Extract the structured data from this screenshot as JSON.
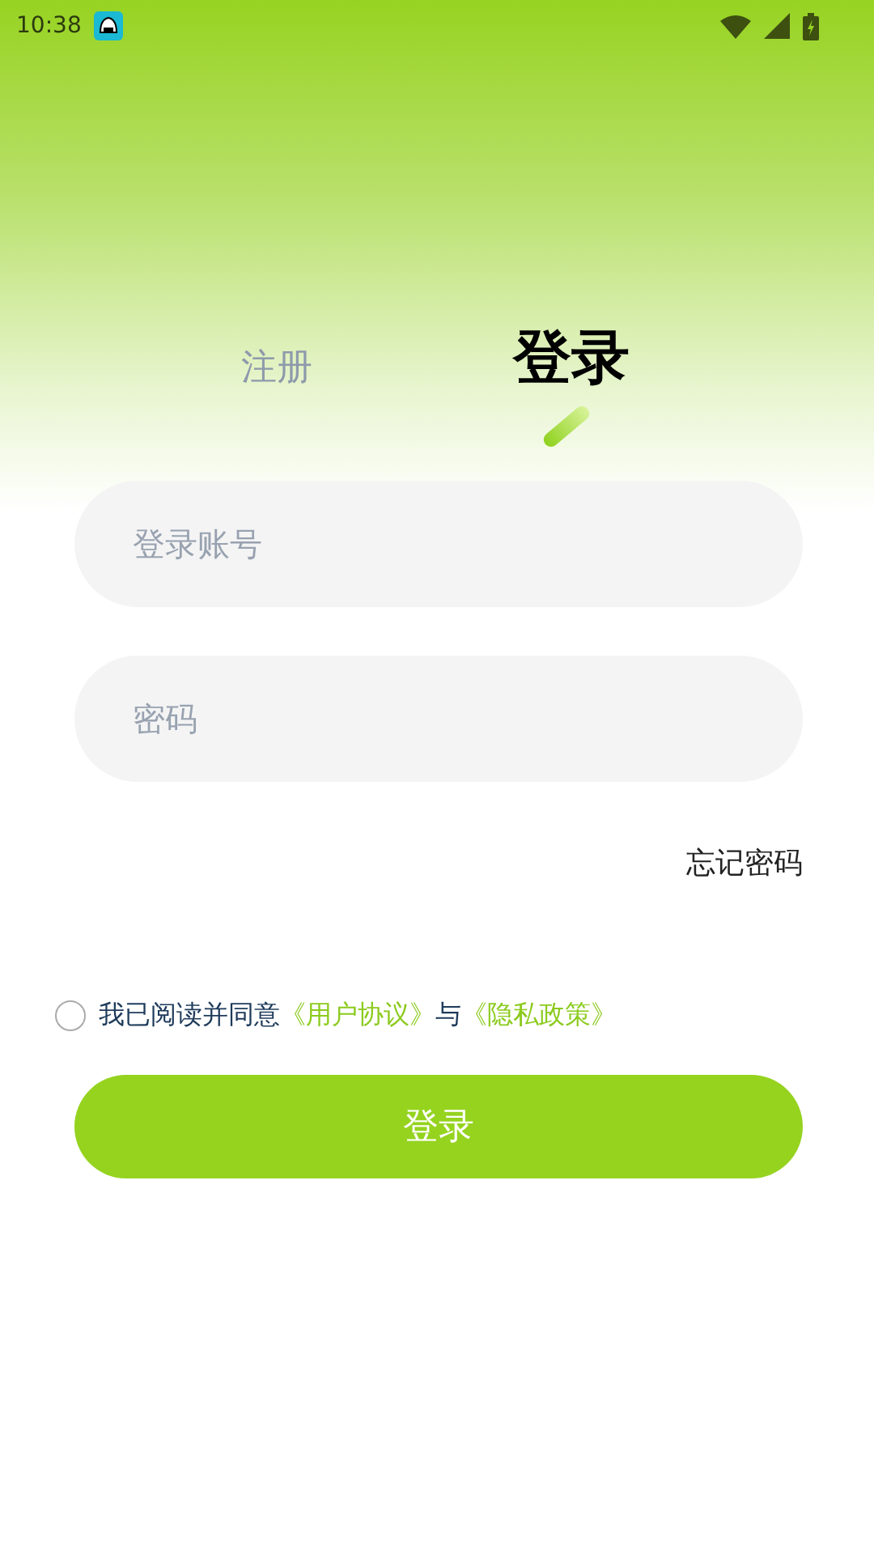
{
  "status_bar": {
    "time": "10:38"
  },
  "tabs": [
    {
      "label": "注册",
      "selected": false
    },
    {
      "label": "登录",
      "selected": true
    }
  ],
  "fields": [
    {
      "placeholder": "登录账号"
    },
    {
      "placeholder": "密码"
    }
  ],
  "forgot_password": "忘记密码",
  "agreement": {
    "checked": false,
    "parts": [
      {
        "kind": "text",
        "text": "我已阅读并同意"
      },
      {
        "kind": "link",
        "text": "《用户协议》"
      },
      {
        "kind": "text",
        "text": "与"
      },
      {
        "kind": "link",
        "text": "《隐私政策》"
      }
    ]
  },
  "submit_button": "登录"
}
